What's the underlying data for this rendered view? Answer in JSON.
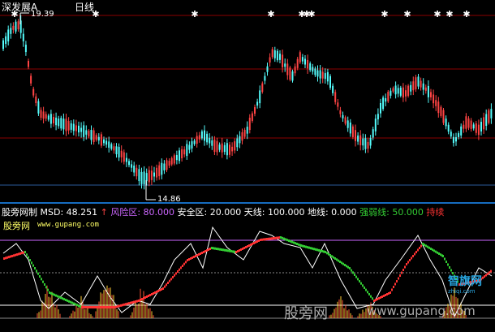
{
  "header": {
    "stock_name": "深发展A",
    "period": "日线",
    "high_label": "19.39",
    "low_label": "14.86"
  },
  "indicator": {
    "legend": [
      {
        "text": "股旁网制",
        "color": "#ffffff"
      },
      {
        "text": " MSD: 48.251",
        "color": "#ffffff"
      },
      {
        "text": " ↑",
        "color": "#ff4444"
      },
      {
        "text": " 风险区: 80.000",
        "color": "#cc66ff"
      },
      {
        "text": " 安全区: 20.000",
        "color": "#ffffff"
      },
      {
        "text": " 天线: 100.000",
        "color": "#ffffff"
      },
      {
        "text": " 地线: 0.000",
        "color": "#ffffff"
      },
      {
        "text": " 强弱线: 50.000",
        "color": "#33cc33"
      },
      {
        "text": " 持续",
        "color": "#ff3333"
      }
    ],
    "site_name": "股旁网",
    "site_url": "www.gupang.com"
  },
  "watermark": {
    "text": "股旁网",
    "url": "www.gupang.com",
    "logo_text": "智旗网",
    "logo_sub": "zhiqi.com"
  },
  "colors": {
    "up": "#ff4444",
    "down": "#54fcfc",
    "red_line": "#8b0000",
    "blue_line": "#2a5a9a",
    "separator": "#1e90ff"
  }
}
